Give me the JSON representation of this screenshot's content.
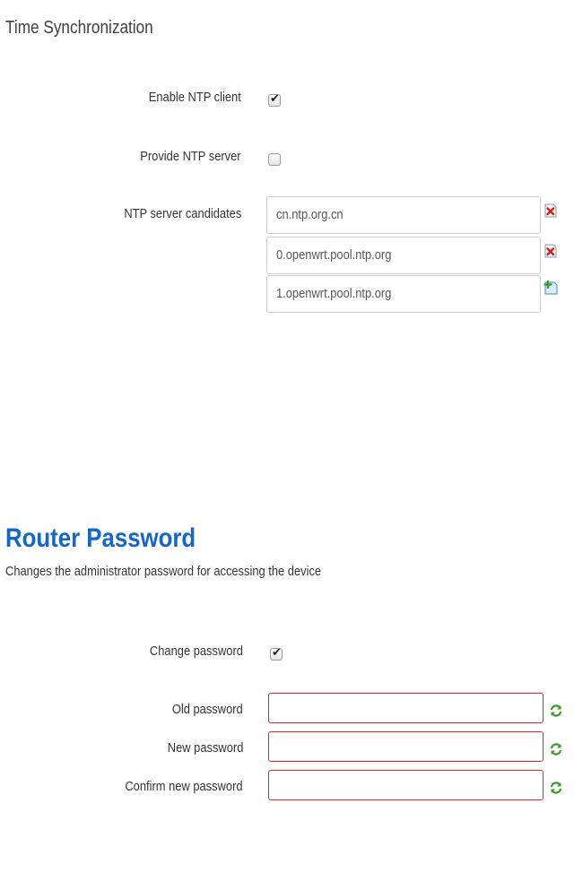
{
  "time_sync": {
    "title": "Time Synchronization",
    "enable_ntp_client": {
      "label": "Enable NTP client",
      "checked": true
    },
    "provide_ntp_server": {
      "label": "Provide NTP server",
      "checked": false
    },
    "ntp_candidates": {
      "label": "NTP server candidates",
      "servers": [
        {
          "value": "cn.ntp.org.cn",
          "action_icon": "remove-icon"
        },
        {
          "value": "0.openwrt.pool.ntp.org",
          "action_icon": "remove-icon"
        },
        {
          "value": "1.openwrt.pool.ntp.org",
          "action_icon": "add-icon"
        }
      ]
    }
  },
  "router_password": {
    "title": "Router Password",
    "description": "Changes the administrator password for accessing the device",
    "change_password": {
      "label": "Change password",
      "checked": true
    },
    "old_password": {
      "label": "Old password",
      "value": ""
    },
    "new_password": {
      "label": "New password",
      "value": ""
    },
    "confirm_password": {
      "label": "Confirm new password",
      "value": ""
    },
    "reveal_icon": "reload-icon"
  },
  "colors": {
    "title_blue": "#1467c9",
    "error_border": "#e0242a",
    "remove_red": "#d42020",
    "reload_green": "#3a9a2a"
  }
}
